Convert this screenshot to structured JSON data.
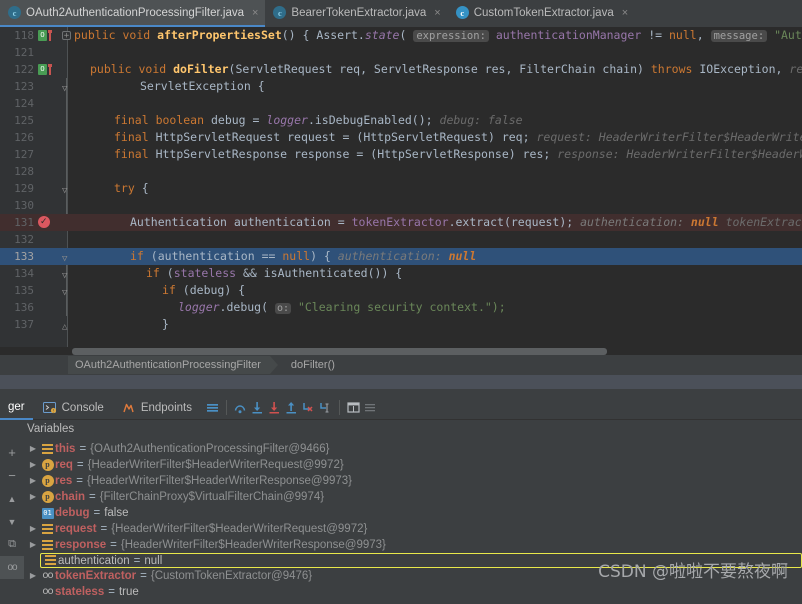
{
  "tabs": [
    {
      "label": "OAuth2AuthenticationProcessingFilter.java",
      "icon": "java-class-icon",
      "active": true,
      "close": "×"
    },
    {
      "label": "BearerTokenExtractor.java",
      "icon": "java-class-icon",
      "active": false,
      "close": "×"
    },
    {
      "label": "CustomTokenExtractor.java",
      "icon": "java-class-icon",
      "active": false,
      "close": "×"
    }
  ],
  "editor": {
    "lines": [
      {
        "n": "118",
        "marker": "run-method",
        "fold": "plus"
      },
      {
        "n": "121",
        "marker": "",
        "fold": ""
      },
      {
        "n": "122",
        "marker": "run-method",
        "fold": ""
      },
      {
        "n": "123",
        "marker": "",
        "fold": "collapse"
      },
      {
        "n": "124",
        "marker": "",
        "fold": ""
      },
      {
        "n": "125",
        "marker": "",
        "fold": ""
      },
      {
        "n": "126",
        "marker": "",
        "fold": ""
      },
      {
        "n": "127",
        "marker": "",
        "fold": ""
      },
      {
        "n": "128",
        "marker": "",
        "fold": ""
      },
      {
        "n": "129",
        "marker": "",
        "fold": "collapse"
      },
      {
        "n": "130",
        "marker": "",
        "fold": ""
      },
      {
        "n": "131",
        "marker": "breakpoint",
        "fold": ""
      },
      {
        "n": "132",
        "marker": "",
        "fold": ""
      },
      {
        "n": "133",
        "marker": "",
        "fold": "collapse"
      },
      {
        "n": "134",
        "marker": "",
        "fold": "collapse"
      },
      {
        "n": "135",
        "marker": "",
        "fold": "collapse"
      },
      {
        "n": "136",
        "marker": "",
        "fold": ""
      },
      {
        "n": "137",
        "marker": "",
        "fold": "cap"
      }
    ],
    "code": {
      "l118": {
        "kw_public": "public",
        "kw_void": "void",
        "method": "afterPropertiesSet",
        "parens": "() {",
        "assert": "Assert.",
        "state": "state",
        "open": "(",
        "inlay_expression": "expression:",
        "field": "authenticationManager",
        "neq": "!=",
        "null": "null",
        "comma": ",",
        "inlay_message": "message:",
        "strpart": "\"Authentic"
      },
      "l122": {
        "kw_public": "public",
        "kw_void": "void",
        "method": "doFilter",
        "sig": "(ServletRequest req, ServletResponse res, FilterChain chain)",
        "kw_throws": "throws",
        "exc": "IOException,",
        "hint": "req: Hea"
      },
      "l123": {
        "text": "ServletException {"
      },
      "l125": {
        "kw_final": "final",
        "kw_boolean": "boolean",
        "var": "debug",
        "eq": "=",
        "logger": "logger",
        "call": ".isDebugEnabled();",
        "hint": "debug: false"
      },
      "l126": {
        "kw_final": "final",
        "type": "HttpServletRequest",
        "var": "request",
        "eq": "=",
        "cast": "(HttpServletRequest)",
        "val": "req;",
        "hint": "request: HeaderWriterFilter$HeaderWriterRequ"
      },
      "l127": {
        "kw_final": "final",
        "type": "HttpServletResponse",
        "var": "response",
        "eq": "=",
        "cast": "(HttpServletResponse)",
        "val": "res;",
        "hint": "response: HeaderWriterFilter$HeaderWriter"
      },
      "l129": {
        "kw_try": "try",
        "brace": "{"
      },
      "l131": {
        "type": "Authentication",
        "var": "authentication",
        "eq": "=",
        "field": "tokenExtractor",
        "call": ".extract(request);",
        "hint_key": "authentication:",
        "hint_val": "null",
        "hint2": "tokenExtractor"
      },
      "l133": {
        "kw_if": "if",
        "cond_open": "(authentication ==",
        "null": "null",
        "cond_close": ") {",
        "hint_key": "authentication:",
        "hint_val": "null"
      },
      "l134": {
        "kw_if": "if",
        "open": "(",
        "field": "stateless",
        "and": "&& isAuthenticated()) {"
      },
      "l135": {
        "kw_if": "if",
        "rest": "(debug) {"
      },
      "l136": {
        "logger": "logger",
        "call": ".debug(",
        "inlay": "o:",
        "str": "\"Clearing security context.\");"
      },
      "l137": {
        "text": "}"
      }
    }
  },
  "breadcrumb": {
    "class": "OAuth2AuthenticationProcessingFilter",
    "method": "doFilter()"
  },
  "debug_toolbar": {
    "tabs": [
      {
        "label": "ger",
        "icon": "",
        "active": true
      },
      {
        "label": "Console",
        "icon": "console-icon",
        "active": false
      },
      {
        "label": "Endpoints",
        "icon": "endpoints-icon",
        "active": false
      }
    ],
    "actions": [
      {
        "name": "show-execution-point-icon",
        "glyph": "≡"
      },
      {
        "name": "step-over-icon",
        "glyph": "⤴"
      },
      {
        "name": "step-into-icon",
        "glyph": "⬇"
      },
      {
        "name": "force-step-into-icon",
        "glyph": "⬇"
      },
      {
        "name": "step-out-icon",
        "glyph": "⬆"
      },
      {
        "name": "drop-frame-icon",
        "glyph": "⤶"
      },
      {
        "name": "run-to-cursor-icon",
        "glyph": "⤷"
      },
      {
        "name": "evaluate-expression-icon",
        "glyph": "▦"
      },
      {
        "name": "settings-icon",
        "glyph": "≣"
      }
    ]
  },
  "variables_header": {
    "label": "Variables"
  },
  "variables_toolbar": [
    {
      "name": "add-watch-button",
      "glyph": "+"
    },
    {
      "name": "remove-watch-button",
      "glyph": "−"
    },
    {
      "name": "move-up-button",
      "glyph": "▲"
    },
    {
      "name": "move-down-button",
      "glyph": "▼"
    },
    {
      "name": "copy-value-button",
      "glyph": "⧉"
    },
    {
      "name": "watches-button",
      "glyph": "oo"
    }
  ],
  "variables": [
    {
      "expand": true,
      "icon": "object-icon",
      "name": "this",
      "eq": "=",
      "value": "{OAuth2AuthenticationProcessingFilter@9466}",
      "selected": false
    },
    {
      "expand": true,
      "icon": "parameter-icon",
      "name": "req",
      "eq": "=",
      "value": "{HeaderWriterFilter$HeaderWriterRequest@9972}",
      "selected": false
    },
    {
      "expand": true,
      "icon": "parameter-icon",
      "name": "res",
      "eq": "=",
      "value": "{HeaderWriterFilter$HeaderWriterResponse@9973}",
      "selected": false
    },
    {
      "expand": true,
      "icon": "parameter-icon",
      "name": "chain",
      "eq": "=",
      "value": "{FilterChainProxy$VirtualFilterChain@9974}",
      "selected": false
    },
    {
      "expand": false,
      "icon": "primitive-icon",
      "name": "debug",
      "eq": "=",
      "value": "false",
      "literal": true,
      "selected": false
    },
    {
      "expand": true,
      "icon": "object-icon",
      "name": "request",
      "eq": "=",
      "value": "{HeaderWriterFilter$HeaderWriterRequest@9972}",
      "selected": false
    },
    {
      "expand": true,
      "icon": "object-icon",
      "name": "response",
      "eq": "=",
      "value": "{HeaderWriterFilter$HeaderWriterResponse@9973}",
      "selected": false
    },
    {
      "expand": false,
      "icon": "object-icon",
      "name": "authentication",
      "eq": "=",
      "value": "null",
      "literal": true,
      "selected": true
    },
    {
      "expand": true,
      "icon": "watch-icon",
      "name": "tokenExtractor",
      "eq": "=",
      "value": "{CustomTokenExtractor@9476}",
      "selected": false
    },
    {
      "expand": false,
      "icon": "watch-icon",
      "name": "stateless",
      "eq": "=",
      "value": "true",
      "literal": true,
      "selected": false
    }
  ],
  "watermark": {
    "text": "CSDN @啦啦不要熬夜啊"
  },
  "colors": {
    "editor_bg": "#2b2b2b",
    "panel_bg": "#3c3f41",
    "accent_blue": "#4a88c7",
    "exec_line": "#2f5179",
    "breakpoint_line": "#412e2e",
    "selection_yellow": "#e8e84a",
    "keyword_orange": "#cc7832",
    "string_green": "#6a8759",
    "field_purple": "#9876aa",
    "method_yellow": "#ffc66d",
    "var_name_red": "#bf6060"
  }
}
